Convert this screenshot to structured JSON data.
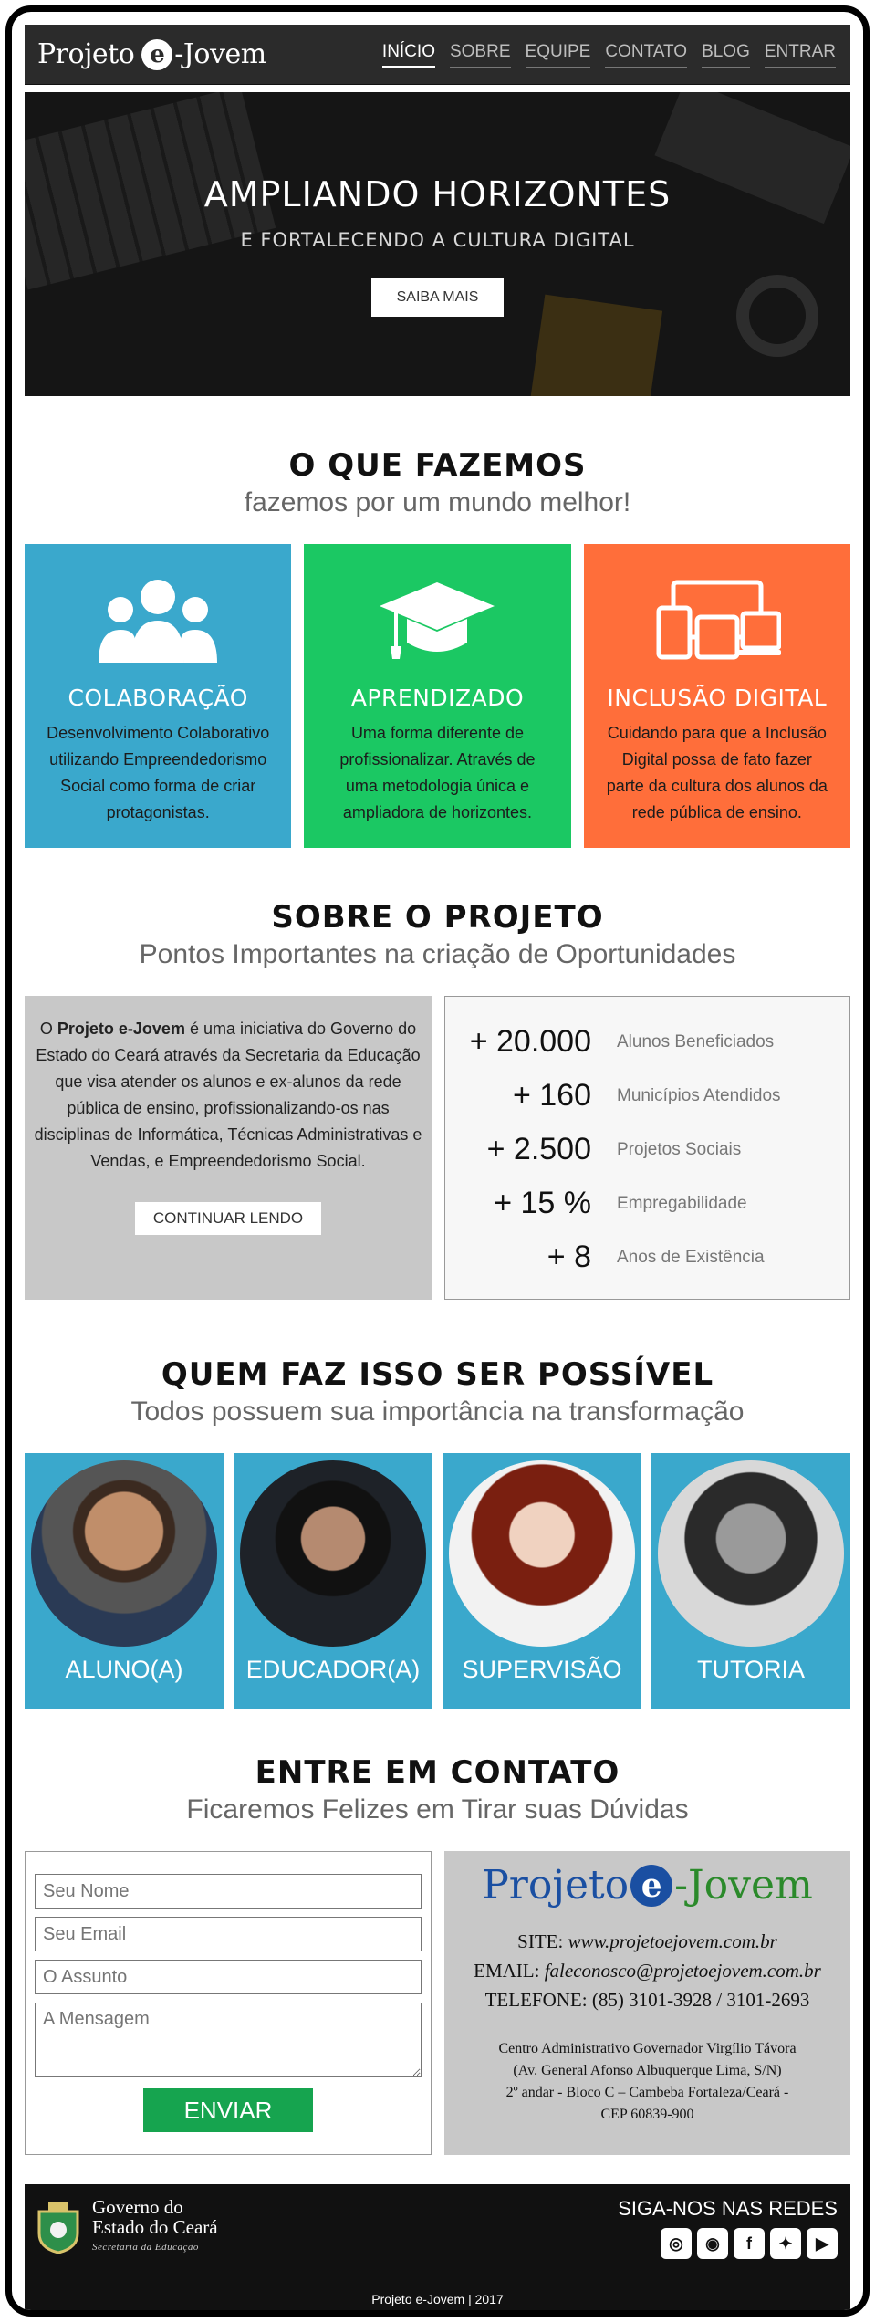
{
  "nav": {
    "logo_left": "Projeto",
    "logo_e": "e",
    "logo_right": "-Jovem",
    "items": [
      {
        "label": "INÍCIO",
        "active": true
      },
      {
        "label": "SOBRE"
      },
      {
        "label": "EQUIPE"
      },
      {
        "label": "CONTATO"
      },
      {
        "label": "BLOG"
      },
      {
        "label": "ENTRAR"
      }
    ]
  },
  "hero": {
    "title": "AMPLIANDO HORIZONTES",
    "subtitle": "E FORTALECENDO A CULTURA DIGITAL",
    "button": "SAIBA MAIS"
  },
  "what": {
    "title": "O QUE FAZEMOS",
    "subtitle": "fazemos por um mundo melhor!",
    "cards": [
      {
        "title": "COLABORAÇÃO",
        "text": "Desenvolvimento Colaborativo utilizando Empreendedorismo Social como forma de criar protagonistas.",
        "icon": "users-icon",
        "color": "#3aa8cc"
      },
      {
        "title": "APRENDIZADO",
        "text": "Uma forma diferente de profissionalizar. Através de uma metodologia única e ampliadora de horizontes.",
        "icon": "graduation-cap-icon",
        "color": "#1bc863"
      },
      {
        "title": "INCLUSÃO DIGITAL",
        "text": "Cuidando para que a Inclusão Digital possa de fato fazer parte da cultura dos alunos da rede pública de ensino.",
        "icon": "devices-icon",
        "color": "#ff6e3a"
      }
    ]
  },
  "about": {
    "title": "SOBRE O PROJETO",
    "subtitle": "Pontos Importantes na criação de Oportunidades",
    "text_prefix": "O ",
    "text_bold": "Projeto e-Jovem",
    "text_rest": " é uma iniciativa do Governo do Estado do Ceará através da Secretaria da Educação que visa atender os alunos e ex-alunos da rede pública de ensino, profissionalizando-os nas disciplinas de Informática, Técnicas Administrativas e Vendas, e Empreendedorismo Social.",
    "button": "CONTINUAR LENDO",
    "stats": [
      {
        "value": "+ 20.000",
        "label": "Alunos Beneficiados"
      },
      {
        "value": "+ 160",
        "label": "Municípios Atendidos"
      },
      {
        "value": "+ 2.500",
        "label": "Projetos Sociais"
      },
      {
        "value": "+ 15 %",
        "label": "Empregabilidade"
      },
      {
        "value": "+ 8",
        "label": "Anos de Existência"
      }
    ]
  },
  "team": {
    "title": "QUEM FAZ ISSO SER POSSÍVEL",
    "subtitle": "Todos possuem sua importância na transformação",
    "roles": [
      "ALUNO(A)",
      "EDUCADOR(A)",
      "SUPERVISÃO",
      "TUTORIA"
    ]
  },
  "contact": {
    "title": "ENTRE EM CONTATO",
    "subtitle": "Ficaremos Felizes em Tirar suas Dúvidas",
    "name_placeholder": "Seu Nome",
    "email_placeholder": "Seu Email",
    "subject_placeholder": "O Assunto",
    "message_placeholder": "A Mensagem",
    "send": "ENVIAR",
    "brand_left": "Projeto",
    "brand_e": "e",
    "brand_right": "-Jovem",
    "site_label": "SITE: ",
    "site": "www.projetoejovem.com.br",
    "email_label": "EMAIL: ",
    "email": "faleconosco@projetoejovem.com.br",
    "phone": "TELEFONE: (85) 3101-3928 / 3101-2693",
    "address": [
      "Centro Administrativo Governador Virgílio Távora",
      "(Av. General Afonso Albuquerque Lima, S/N)",
      "2º andar - Bloco C – Cambeba Fortaleza/Ceará -",
      "CEP 60839-900"
    ]
  },
  "footer": {
    "gov_line1": "Governo do",
    "gov_line2": "Estado do Ceará",
    "gov_line3": "Secretaria da Educação",
    "social_title": "SIGA-NOS NAS REDES",
    "copyright": "Projeto e-Jovem | 2017"
  }
}
